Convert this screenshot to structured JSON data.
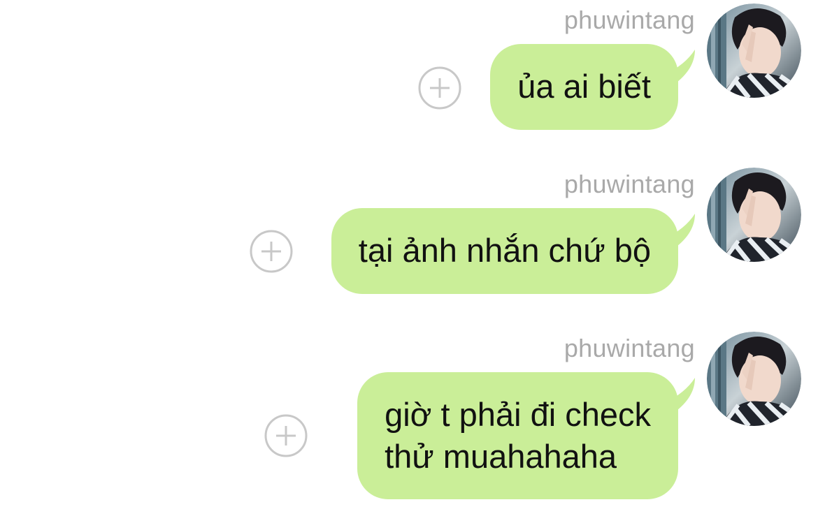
{
  "messages": [
    {
      "sender": "phuwintang",
      "text_lines": [
        "ủa ai biết"
      ]
    },
    {
      "sender": "phuwintang",
      "text_lines": [
        "tại ảnh nhắn chứ bộ"
      ]
    },
    {
      "sender": "phuwintang",
      "text_lines": [
        "giờ t phải đi check",
        "thử muahahaha"
      ]
    }
  ],
  "icons": {
    "add": "plus-circle-icon",
    "avatar": "user-avatar"
  },
  "colors": {
    "bubble": "#caee98",
    "sender": "#a9a9a9",
    "add_icon": "#c8c8c8"
  }
}
